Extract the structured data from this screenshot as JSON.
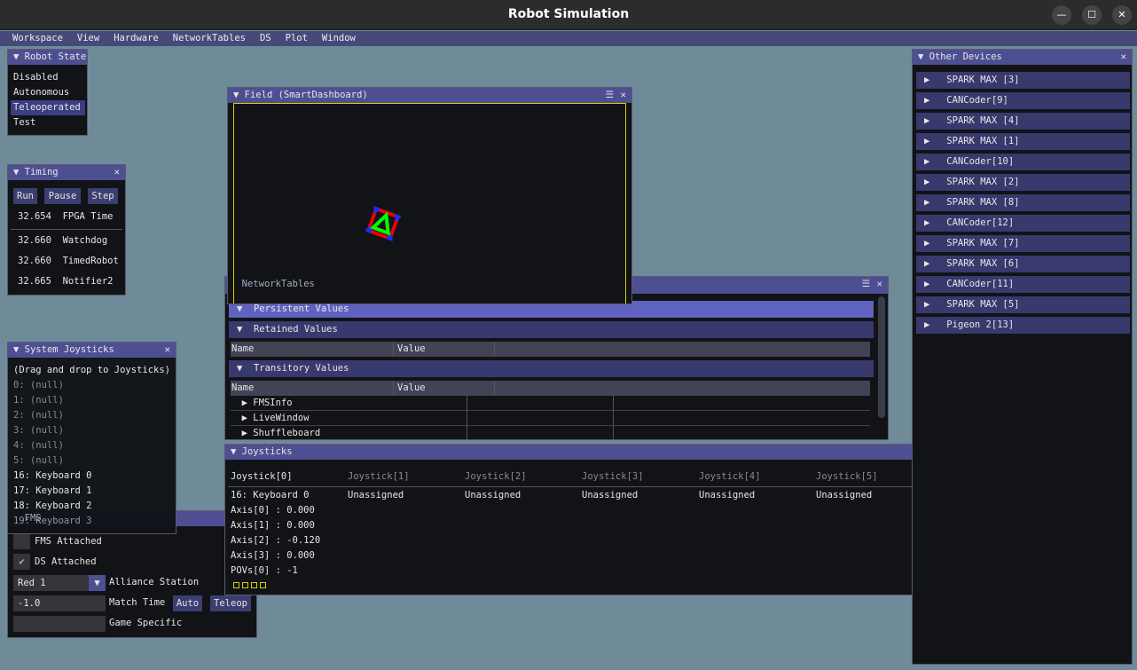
{
  "app": {
    "title": "Robot Simulation",
    "controls": [
      "minimize",
      "maximize",
      "close"
    ]
  },
  "menu": [
    "Workspace",
    "View",
    "Hardware",
    "NetworkTables",
    "DS",
    "Plot",
    "Window"
  ],
  "robot_state": {
    "title": "Robot State",
    "items": [
      "Disabled",
      "Autonomous",
      "Teleoperated",
      "Test"
    ],
    "selected": "Teleoperated"
  },
  "timing": {
    "title": "Timing",
    "buttons": [
      "Run",
      "Pause",
      "Step"
    ],
    "rows": [
      {
        "value": "32.654",
        "label": "FPGA Time"
      },
      {
        "value": "32.660",
        "label": "Watchdog"
      },
      {
        "value": "32.660",
        "label": "TimedRobot"
      },
      {
        "value": "32.665",
        "label": "Notifier2"
      }
    ]
  },
  "system_joysticks": {
    "title": "System Joysticks",
    "hint": "(Drag and drop to Joysticks)",
    "items": [
      "0: (null)",
      "1: (null)",
      "2: (null)",
      "3: (null)",
      "4: (null)",
      "5: (null)",
      "16: Keyboard 0",
      "17: Keyboard 1",
      "18: Keyboard 2",
      "19: Keyboard 3"
    ]
  },
  "fms": {
    "title": "FMS",
    "fms_attached": "FMS Attached",
    "fms_attached_checked": false,
    "ds_attached": "DS Attached",
    "ds_attached_checked": true,
    "alliance_value": "Red 1",
    "alliance_label": "Alliance Station",
    "match_time_value": "-1.0",
    "match_time_label": "Match Time",
    "auto": "Auto",
    "teleop": "Teleop",
    "game_specific_value": "",
    "game_specific_label": "Game Specific"
  },
  "field": {
    "title": "Field (SmartDashboard)",
    "border_color": "#d8d000"
  },
  "networktables": {
    "title": "NetworkTables",
    "sections": [
      "Persistent Values",
      "Retained Values",
      "Transitory Values"
    ],
    "col_name": "Name",
    "col_value": "Value",
    "entries": [
      "FMSInfo",
      "LiveWindow",
      "Shuffleboard"
    ]
  },
  "joysticks": {
    "title": "Joysticks",
    "headers": [
      "Joystick[0]",
      "Joystick[1]",
      "Joystick[2]",
      "Joystick[3]",
      "Joystick[4]",
      "Joystick[5]"
    ],
    "assigned": [
      "16: Keyboard 0",
      "Unassigned",
      "Unassigned",
      "Unassigned",
      "Unassigned",
      "Unassigned"
    ],
    "details": [
      "Axis[0] : 0.000",
      "Axis[1] : 0.000",
      "Axis[2] : -0.120",
      "Axis[3] : 0.000",
      "POVs[0] : -1"
    ],
    "buttons_count": 4
  },
  "other_devices": {
    "title": "Other Devices",
    "items": [
      "SPARK MAX [3]",
      "CANCoder[9]",
      "SPARK MAX [4]",
      "SPARK MAX [1]",
      "CANCoder[10]",
      "SPARK MAX [2]",
      "SPARK MAX [8]",
      "CANCoder[12]",
      "SPARK MAX [7]",
      "SPARK MAX [6]",
      "CANCoder[11]",
      "SPARK MAX [5]",
      "Pigeon 2[13]"
    ]
  }
}
